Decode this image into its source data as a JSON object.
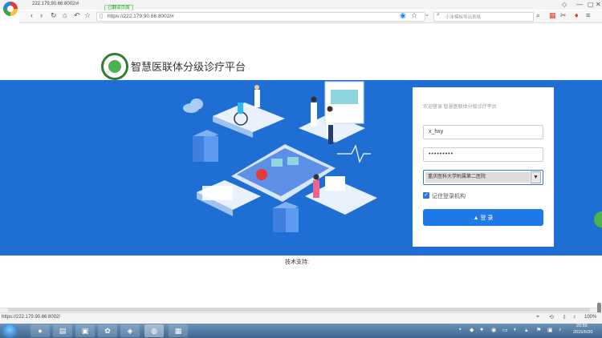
{
  "browser": {
    "tab_title": "222.179.90.66:8002/#",
    "tooltip": "已翻译页面",
    "url": "https://222.179.90.66:8002/#",
    "search_placeholder": "小米模板导出表格",
    "status_url": "https://222.179.90.66:8002/",
    "zoom": "100%"
  },
  "header": {
    "site_title": "智慧医联体分级诊疗平台"
  },
  "login": {
    "welcome": "欢迎登录 智慧医联体分级诊疗平台",
    "username_value": "x_hxy",
    "password_value": "•••••••••",
    "org_selected": "重庆医科大学附属第二医院",
    "org_arrow": "▼",
    "remember_label": "记住登录机构",
    "login_button_label": "▲ 登 录",
    "remember_check": "✓"
  },
  "footer": {
    "tech_support": "技术支持:"
  },
  "taskbar": {
    "time": "20:55",
    "date": "2015/6/20"
  },
  "colors": {
    "banner_blue": "#1e6ed4",
    "button_blue": "#1e7ae6",
    "logo_green": "#2e7d32"
  }
}
